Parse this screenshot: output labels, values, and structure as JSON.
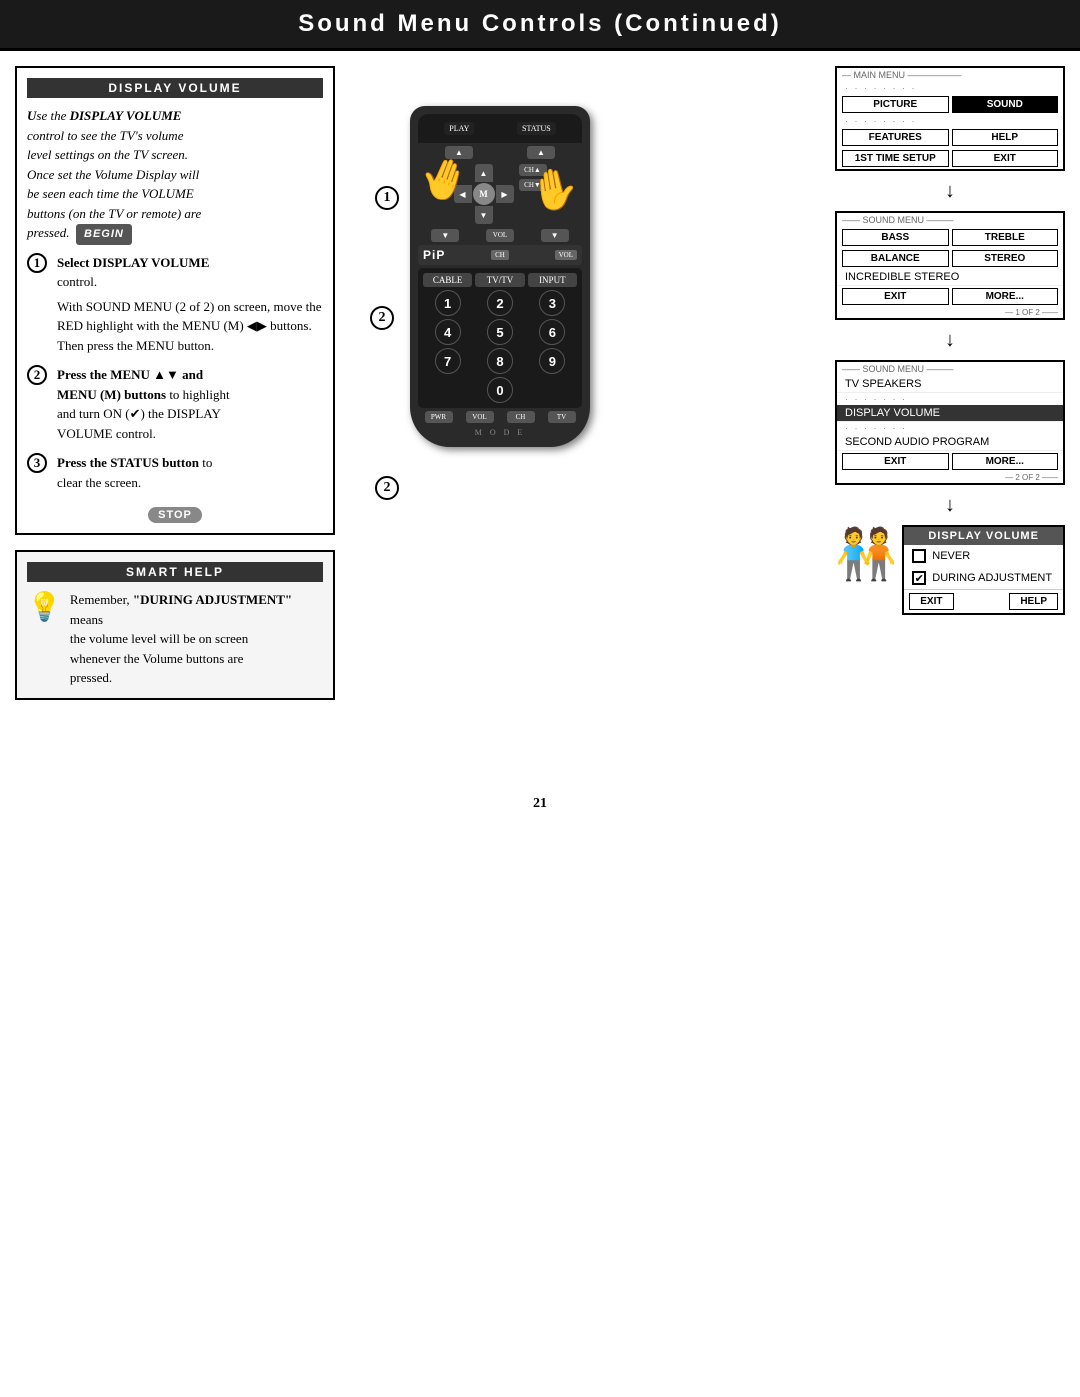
{
  "page": {
    "title": "Sound Menu Controls (Continued)",
    "number": "21"
  },
  "header": {
    "title": "Sound Menu Controls (Continued)"
  },
  "display_volume_section": {
    "header": "DISPLAY VOLUME",
    "intro": "Use the DISPLAY VOLUME control to see the TV's volume level settings on the TV screen. Once set the Volume Display will be seen each time the VOLUME buttons (on the TV or remote) are pressed.",
    "begin_label": "BEGIN",
    "step1_number": "1",
    "step1_text": "Select DISPLAY VOLUME control.",
    "step1_detail": "With SOUND MENU (2 of 2) on screen, move the RED highlight with the MENU (M) ◀▶ buttons. Then press the MENU button.",
    "step2_number": "2",
    "step2_text": "Press the MENU ▲▼ and MENU (M) buttons to highlight and turn ON (✔) the DISPLAY VOLUME control.",
    "step3_number": "3",
    "step3_text": "Press the STATUS button to clear the screen.",
    "stop_label": "STOP"
  },
  "smart_help": {
    "header": "SMART HELP",
    "text": "Remember, \"DURING ADJUSTMENT\" means the volume level will be on screen whenever the Volume buttons are pressed."
  },
  "main_menu_screen": {
    "label": "MAIN MENU",
    "items": [
      "PICTURE",
      "SOUND",
      "FEATURES",
      "HELP",
      "1ST TIME SETUP",
      "EXIT"
    ],
    "dots": "· · · · · ·"
  },
  "sound_menu_1": {
    "label": "SOUND MENU",
    "items": [
      "BASS",
      "TREBLE",
      "BALANCE",
      "STEREO",
      "INCREDIBLE STEREO"
    ],
    "footer_left": "EXIT",
    "footer_right": "MORE...",
    "page_label": "1 OF 2"
  },
  "sound_menu_2": {
    "label": "SOUND MENU",
    "items": [
      "TV SPEAKERS",
      "DISPLAY VOLUME",
      "SECOND AUDIO PROGRAM"
    ],
    "footer_left": "EXIT",
    "footer_right": "MORE...",
    "page_label": "2 OF 2"
  },
  "display_volume_menu": {
    "title": "DISPLAY VOLUME",
    "option_never": "NEVER",
    "option_during": "DURING ADJUSTMENT",
    "footer_exit": "EXIT",
    "footer_help": "HELP"
  },
  "remote": {
    "pip_label": "PiP",
    "status_btn": "STATUS",
    "play_btn": "PLAY",
    "numbers": [
      "1",
      "2",
      "3",
      "4",
      "5",
      "6",
      "7",
      "8",
      "9",
      "0"
    ],
    "channel_btn": "CH",
    "volume_btn": "VOL",
    "menu_btn": "M",
    "power_btn": "POWER",
    "mode_label": "M O D E"
  }
}
